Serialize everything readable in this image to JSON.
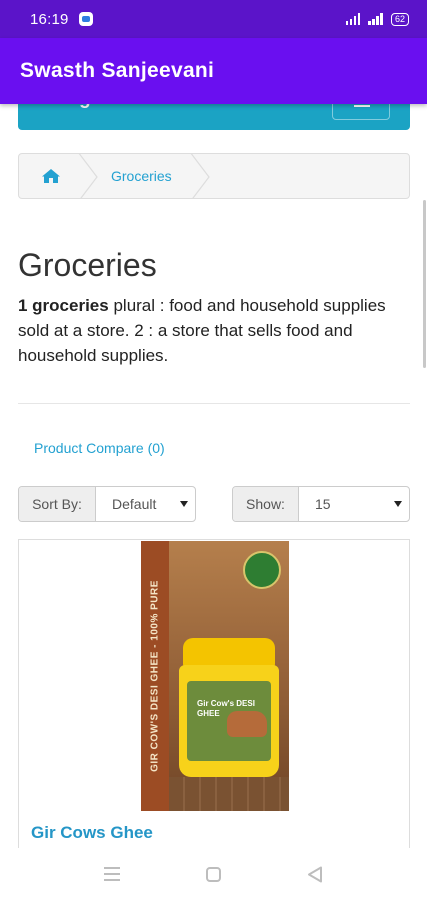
{
  "status_bar": {
    "time": "16:19",
    "indicators": "⁴⁶ .ıl ⁴⁶.ıl",
    "battery": "62"
  },
  "app_bar": {
    "title": "Swasth Sanjeevani"
  },
  "categories": {
    "label": "Categories"
  },
  "breadcrumb": {
    "items": [
      "Groceries"
    ]
  },
  "page": {
    "title": "Groceries",
    "description_bold": "1 groceries",
    "description_rest": " plural : food and household supplies sold at a store. 2 : a store that sells food and household supplies."
  },
  "compare": {
    "label": "Product Compare (0)"
  },
  "sort": {
    "label": "Sort By:",
    "value": "Default"
  },
  "show": {
    "label": "Show:",
    "value": "15"
  },
  "product": {
    "name": "Gir Cows Ghee",
    "image_band_text": "GIR COW'S DESI GHEE - 100% PURE",
    "image_label_text": "Gir Cow's DESI GHEE"
  },
  "colors": {
    "status_bar": "#5b14c9",
    "app_bar": "#6a0ff0",
    "categories_bar": "#1ba3c4",
    "link": "#23a1d1",
    "product_name": "#2596c7"
  }
}
